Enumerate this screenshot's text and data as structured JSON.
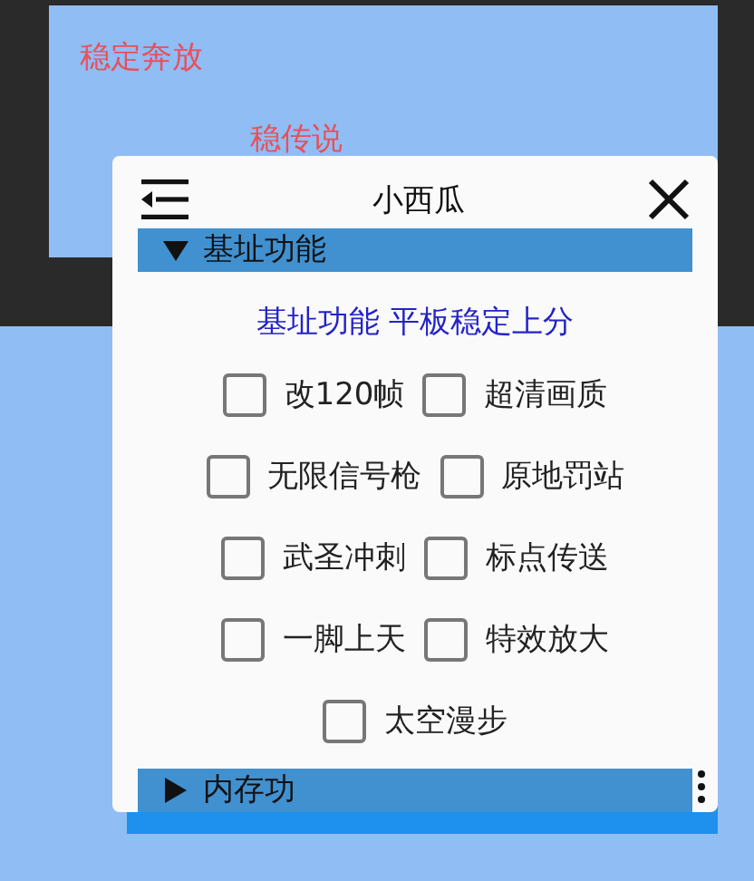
{
  "background_labels": [
    {
      "text": "稳定奔放"
    },
    {
      "text": "稳传说"
    }
  ],
  "dialog": {
    "title": "小西瓜",
    "sections": [
      {
        "label": "基址功能",
        "expanded": true,
        "subtitle": "基址功能 平板稳定上分",
        "rows": [
          [
            {
              "label": "改120帧",
              "checked": false
            },
            {
              "label": "超清画质",
              "checked": false
            }
          ],
          [
            {
              "label": "无限信号枪",
              "checked": false
            },
            {
              "label": "原地罚站",
              "checked": false
            }
          ],
          [
            {
              "label": "武圣冲刺",
              "checked": false
            },
            {
              "label": "标点传送",
              "checked": false
            }
          ],
          [
            {
              "label": "一脚上天",
              "checked": false
            },
            {
              "label": "特效放大",
              "checked": false
            }
          ],
          [
            {
              "label": "太空漫步",
              "checked": false
            }
          ]
        ]
      },
      {
        "label": "内存功",
        "expanded": false
      }
    ]
  }
}
